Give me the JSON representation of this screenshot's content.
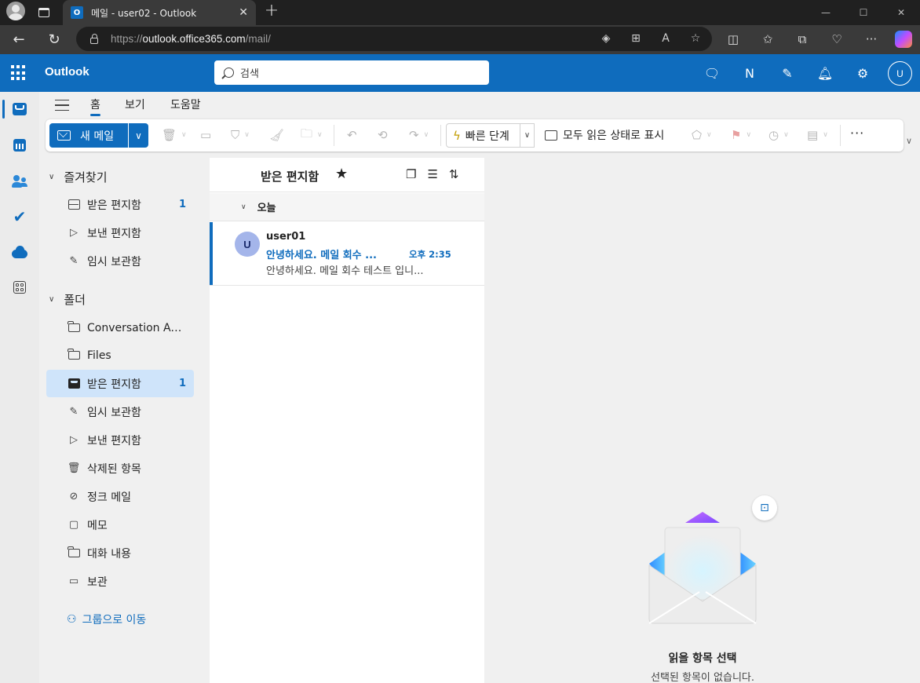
{
  "browser": {
    "tab_title": "메일 - user02 - Outlook",
    "url_scheme": "https://",
    "url_host": "outlook.office365.com",
    "url_path": "/mail/"
  },
  "header": {
    "brand": "Outlook",
    "search_placeholder": "검색",
    "user_initial": "U"
  },
  "ribbon": {
    "tabs": [
      "홈",
      "보기",
      "도움말"
    ],
    "new_mail": "새 메일",
    "quick_steps": "빠른 단계",
    "mark_all_read": "모두 읽은 상태로 표시"
  },
  "folders": {
    "favorites_label": "즐겨찾기",
    "favorites": [
      {
        "label": "받은 편지함",
        "count": "1",
        "icon": "inbox-icon"
      },
      {
        "label": "보낸 편지함",
        "count": "",
        "icon": "send-icon"
      },
      {
        "label": "임시 보관함",
        "count": "",
        "icon": "drafts-icon"
      }
    ],
    "folders_label": "폴더",
    "items": [
      {
        "label": "Conversation Acti...",
        "count": "",
        "icon": "folder-icon"
      },
      {
        "label": "Files",
        "count": "",
        "icon": "folder-icon"
      },
      {
        "label": "받은 편지함",
        "count": "1",
        "icon": "inbox-icon",
        "selected": true
      },
      {
        "label": "임시 보관함",
        "count": "",
        "icon": "drafts-icon"
      },
      {
        "label": "보낸 편지함",
        "count": "",
        "icon": "send-icon"
      },
      {
        "label": "삭제된 항목",
        "count": "",
        "icon": "trash-icon"
      },
      {
        "label": "정크 메일",
        "count": "",
        "icon": "junk-icon"
      },
      {
        "label": "메모",
        "count": "",
        "icon": "note-icon"
      },
      {
        "label": "대화 내용",
        "count": "",
        "icon": "folder-icon"
      },
      {
        "label": "보관",
        "count": "",
        "icon": "archive-icon"
      }
    ],
    "goto_groups": "그룹으로 이동"
  },
  "message_list": {
    "title": "받은 편지함",
    "group_label": "오늘",
    "messages": [
      {
        "avatar": "U",
        "from": "user01",
        "subject": "안녕하세요. 메일 회수 ...",
        "time": "오후 2:35",
        "preview": "안녕하세요. 메일 회수 테스트 입니..."
      }
    ]
  },
  "reading_pane": {
    "title": "읽을 항목 선택",
    "subtitle": "선택된 항목이 없습니다."
  },
  "colors": {
    "brand": "#0f6cbd",
    "selected_folder": "#cfe4fa"
  }
}
